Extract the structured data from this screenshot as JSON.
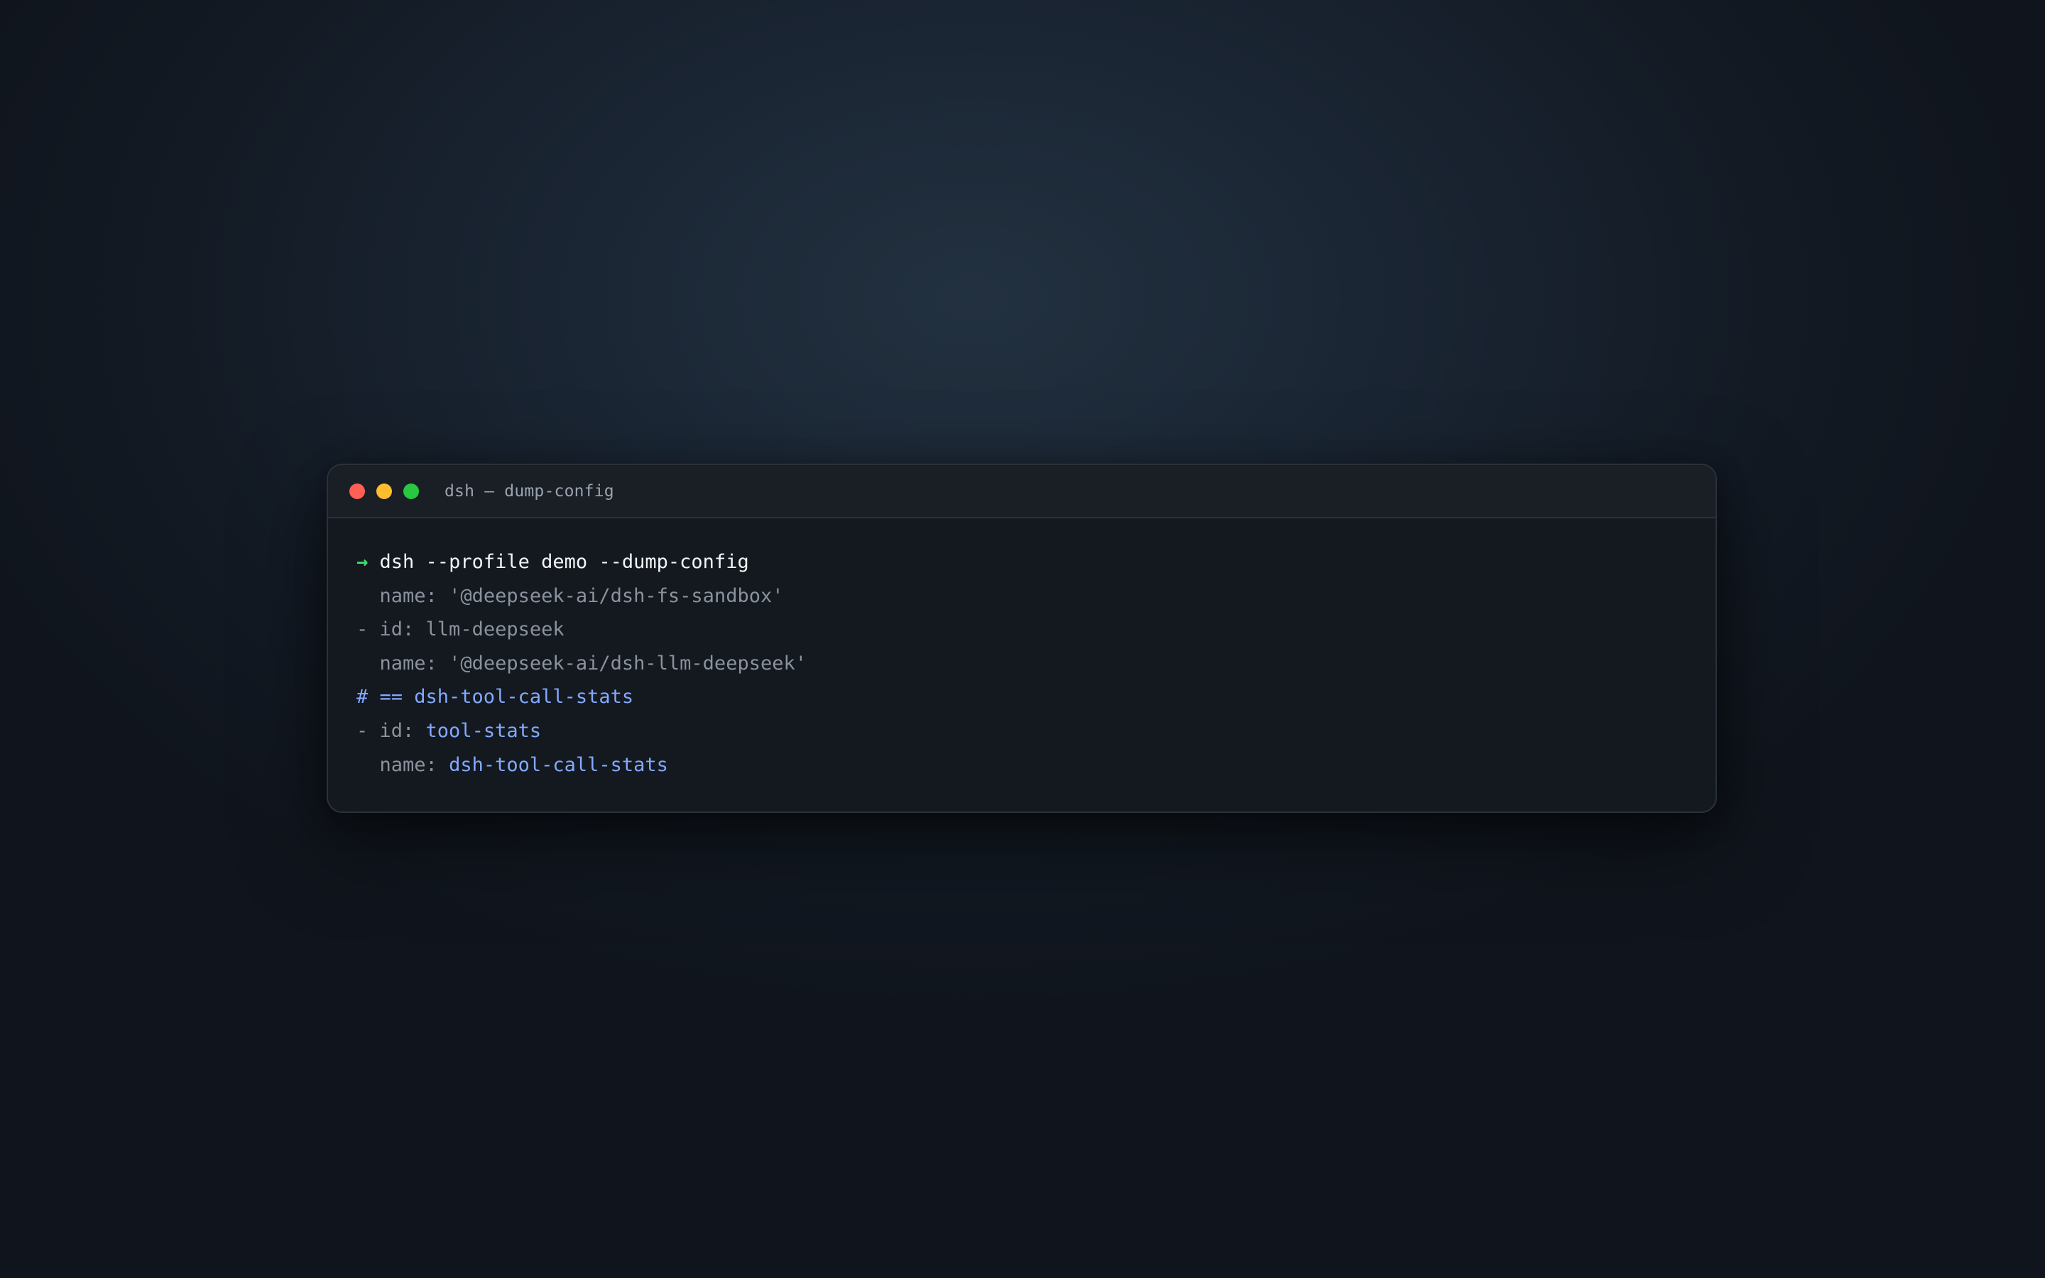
{
  "window": {
    "title": "dsh — dump-config",
    "controls": {
      "close_color": "#ff5f57",
      "minimize_color": "#febc2e",
      "maximize_color": "#28c840"
    }
  },
  "terminal": {
    "prompt_symbol": "→",
    "command": "dsh --profile demo --dump-config",
    "lines": [
      {
        "indent": "  ",
        "key": "name: ",
        "value": "'@deepseek-ai/dsh-fs-sandbox'"
      },
      {
        "indent": "- ",
        "key": "id: ",
        "value": "llm-deepseek"
      },
      {
        "indent": "  ",
        "key": "name: ",
        "value": "'@deepseek-ai/dsh-llm-deepseek'"
      },
      {
        "comment": "# == dsh-tool-call-stats"
      },
      {
        "indent": "- ",
        "key": "id: ",
        "value": "tool-stats"
      },
      {
        "indent": "  ",
        "key": "name: ",
        "value": "dsh-tool-call-stats"
      }
    ]
  },
  "colors": {
    "prompt": "#3ddc6e",
    "command": "#f2f4f7",
    "muted": "#8a939d",
    "accent": "#82aaff"
  }
}
